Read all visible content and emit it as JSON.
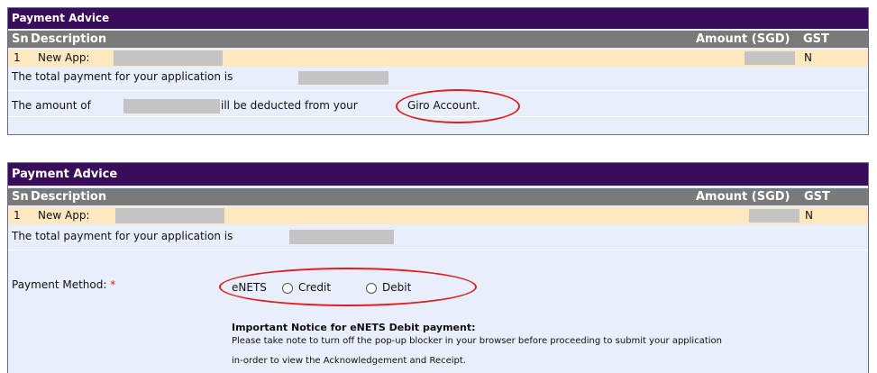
{
  "advice1": {
    "title": "Payment Advice",
    "headers": {
      "sn": "Sn",
      "description": "Description",
      "amount": "Amount (SGD)",
      "gst": "GST"
    },
    "row": {
      "sn": "1",
      "description": "New App:",
      "gst": "N"
    },
    "total_text": "The total payment for your application is",
    "deduct_prefix": "The amount of",
    "deduct_suffix": "ill be deducted from your",
    "deduct_account": "Giro Account."
  },
  "advice2": {
    "title": "Payment Advice",
    "headers": {
      "sn": "Sn",
      "description": "Description",
      "amount": "Amount (SGD)",
      "gst": "GST"
    },
    "row": {
      "sn": "1",
      "description": "New App:",
      "gst": "N"
    },
    "total_text": "The total payment for your application is",
    "payment_method_label": "Payment Method:",
    "required_mark": "*",
    "method_group_label": "eNETS",
    "options": [
      {
        "label": "Credit",
        "selected": false
      },
      {
        "label": "Debit",
        "selected": false
      }
    ],
    "notice_title": "Important Notice for eNETS Debit payment:",
    "notice_line1": "Please take note to turn off the pop-up blocker in your browser before proceeding to submit your application",
    "notice_line2": "in-order to view the Acknowledgement and Receipt."
  },
  "colors": {
    "title_bar": "#3a0d5a",
    "header_row": "#7a7a7a",
    "data_row": "#fde8bf",
    "panel_bg": "#e9eefb",
    "annotation": "#e02020",
    "redaction": "#c4c4c4"
  }
}
